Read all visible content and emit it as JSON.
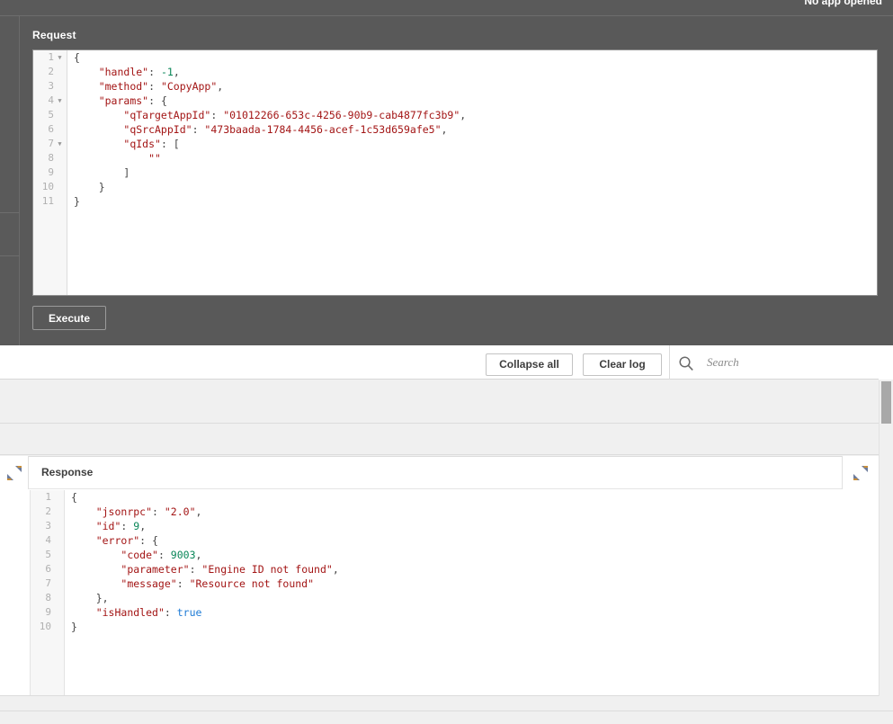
{
  "window": {
    "status_label": "No app opened"
  },
  "request_panel": {
    "title": "Request",
    "execute_label": "Execute",
    "line_count": 11,
    "fold_lines": [
      1,
      4,
      7
    ],
    "json_text": "{\n    \"handle\": -1,\n    \"method\": \"CopyApp\",\n    \"params\": {\n        \"qTargetAppId\": \"01012266-653c-4256-90b9-cab4877fc3b9\",\n        \"qSrcAppId\": \"473baada-1784-4456-acef-1c53d659afe5\",\n        \"qIds\": [\n            \"\"\n        ]\n    }\n}",
    "fields": {
      "handle": -1,
      "method": "CopyApp",
      "qTargetAppId": "01012266-653c-4256-90b9-cab4877fc3b9",
      "qSrcAppId": "473baada-1784-4456-acef-1c53d659afe5",
      "qIds": [
        ""
      ]
    },
    "lines": [
      {
        "n": 1,
        "fold": true,
        "tokens": [
          {
            "t": "{",
            "c": "tk-d"
          }
        ]
      },
      {
        "n": 2,
        "fold": false,
        "tokens": [
          {
            "t": "    ",
            "c": "tk-d"
          },
          {
            "t": "\"handle\"",
            "c": "tk-p"
          },
          {
            "t": ": ",
            "c": "tk-d"
          },
          {
            "t": "-1",
            "c": "tk-n"
          },
          {
            "t": ",",
            "c": "tk-d"
          }
        ]
      },
      {
        "n": 3,
        "fold": false,
        "tokens": [
          {
            "t": "    ",
            "c": "tk-d"
          },
          {
            "t": "\"method\"",
            "c": "tk-p"
          },
          {
            "t": ": ",
            "c": "tk-d"
          },
          {
            "t": "\"CopyApp\"",
            "c": "tk-s"
          },
          {
            "t": ",",
            "c": "tk-d"
          }
        ]
      },
      {
        "n": 4,
        "fold": true,
        "tokens": [
          {
            "t": "    ",
            "c": "tk-d"
          },
          {
            "t": "\"params\"",
            "c": "tk-p"
          },
          {
            "t": ": ",
            "c": "tk-d"
          },
          {
            "t": "{",
            "c": "tk-d"
          }
        ]
      },
      {
        "n": 5,
        "fold": false,
        "tokens": [
          {
            "t": "        ",
            "c": "tk-d"
          },
          {
            "t": "\"qTargetAppId\"",
            "c": "tk-p"
          },
          {
            "t": ": ",
            "c": "tk-d"
          },
          {
            "t": "\"01012266-653c-4256-90b9-cab4877fc3b9\"",
            "c": "tk-s"
          },
          {
            "t": ",",
            "c": "tk-d"
          }
        ]
      },
      {
        "n": 6,
        "fold": false,
        "tokens": [
          {
            "t": "        ",
            "c": "tk-d"
          },
          {
            "t": "\"qSrcAppId\"",
            "c": "tk-p"
          },
          {
            "t": ": ",
            "c": "tk-d"
          },
          {
            "t": "\"473baada-1784-4456-acef-1c53d659afe5\"",
            "c": "tk-s"
          },
          {
            "t": ",",
            "c": "tk-d"
          }
        ]
      },
      {
        "n": 7,
        "fold": true,
        "tokens": [
          {
            "t": "        ",
            "c": "tk-d"
          },
          {
            "t": "\"qIds\"",
            "c": "tk-p"
          },
          {
            "t": ": ",
            "c": "tk-d"
          },
          {
            "t": "[",
            "c": "tk-d"
          }
        ]
      },
      {
        "n": 8,
        "fold": false,
        "tokens": [
          {
            "t": "            ",
            "c": "tk-d"
          },
          {
            "t": "\"\"",
            "c": "tk-s"
          }
        ]
      },
      {
        "n": 9,
        "fold": false,
        "tokens": [
          {
            "t": "        ",
            "c": "tk-d"
          },
          {
            "t": "]",
            "c": "tk-d"
          }
        ]
      },
      {
        "n": 10,
        "fold": false,
        "tokens": [
          {
            "t": "    ",
            "c": "tk-d"
          },
          {
            "t": "}",
            "c": "tk-d"
          }
        ]
      },
      {
        "n": 11,
        "fold": false,
        "tokens": [
          {
            "t": "}",
            "c": "tk-d"
          }
        ]
      }
    ]
  },
  "log_toolbar": {
    "collapse_all_label": "Collapse all",
    "clear_log_label": "Clear log",
    "search_placeholder": "Search",
    "search_value": "",
    "search_icon": "search-icon"
  },
  "response_panel": {
    "title": "Response",
    "expand_left_icon": "expand-diagonal-icon",
    "expand_right_icon": "expand-diagonal-icon",
    "line_count": 10,
    "json_text": "{\n    \"jsonrpc\": \"2.0\",\n    \"id\": 9,\n    \"error\": {\n        \"code\": 9003,\n        \"parameter\": \"Engine ID not found\",\n        \"message\": \"Resource not found\"\n    },\n    \"isHandled\": true\n}",
    "fields": {
      "jsonrpc": "2.0",
      "id": 9,
      "error": {
        "code": 9003,
        "parameter": "Engine ID not found",
        "message": "Resource not found"
      },
      "isHandled": true
    },
    "lines": [
      {
        "n": 1,
        "fold": false,
        "tokens": [
          {
            "t": "{",
            "c": "tk-d"
          }
        ]
      },
      {
        "n": 2,
        "fold": false,
        "tokens": [
          {
            "t": "    ",
            "c": "tk-d"
          },
          {
            "t": "\"jsonrpc\"",
            "c": "tk-p"
          },
          {
            "t": ": ",
            "c": "tk-d"
          },
          {
            "t": "\"2.0\"",
            "c": "tk-s"
          },
          {
            "t": ",",
            "c": "tk-d"
          }
        ]
      },
      {
        "n": 3,
        "fold": false,
        "tokens": [
          {
            "t": "    ",
            "c": "tk-d"
          },
          {
            "t": "\"id\"",
            "c": "tk-p"
          },
          {
            "t": ": ",
            "c": "tk-d"
          },
          {
            "t": "9",
            "c": "tk-n"
          },
          {
            "t": ",",
            "c": "tk-d"
          }
        ]
      },
      {
        "n": 4,
        "fold": false,
        "tokens": [
          {
            "t": "    ",
            "c": "tk-d"
          },
          {
            "t": "\"error\"",
            "c": "tk-p"
          },
          {
            "t": ": ",
            "c": "tk-d"
          },
          {
            "t": "{",
            "c": "tk-d"
          }
        ]
      },
      {
        "n": 5,
        "fold": false,
        "tokens": [
          {
            "t": "        ",
            "c": "tk-d"
          },
          {
            "t": "\"code\"",
            "c": "tk-p"
          },
          {
            "t": ": ",
            "c": "tk-d"
          },
          {
            "t": "9003",
            "c": "tk-n"
          },
          {
            "t": ",",
            "c": "tk-d"
          }
        ]
      },
      {
        "n": 6,
        "fold": false,
        "tokens": [
          {
            "t": "        ",
            "c": "tk-d"
          },
          {
            "t": "\"parameter\"",
            "c": "tk-p"
          },
          {
            "t": ": ",
            "c": "tk-d"
          },
          {
            "t": "\"Engine ID not found\"",
            "c": "tk-s"
          },
          {
            "t": ",",
            "c": "tk-d"
          }
        ]
      },
      {
        "n": 7,
        "fold": false,
        "tokens": [
          {
            "t": "        ",
            "c": "tk-d"
          },
          {
            "t": "\"message\"",
            "c": "tk-p"
          },
          {
            "t": ": ",
            "c": "tk-d"
          },
          {
            "t": "\"Resource not found\"",
            "c": "tk-s"
          }
        ]
      },
      {
        "n": 8,
        "fold": false,
        "tokens": [
          {
            "t": "    ",
            "c": "tk-d"
          },
          {
            "t": "}",
            "c": "tk-d"
          },
          {
            "t": ",",
            "c": "tk-d"
          }
        ]
      },
      {
        "n": 9,
        "fold": false,
        "tokens": [
          {
            "t": "    ",
            "c": "tk-d"
          },
          {
            "t": "\"isHandled\"",
            "c": "tk-p"
          },
          {
            "t": ": ",
            "c": "tk-d"
          },
          {
            "t": "true",
            "c": "tk-b"
          }
        ]
      },
      {
        "n": 10,
        "fold": false,
        "tokens": [
          {
            "t": "}",
            "c": "tk-d"
          }
        ]
      }
    ]
  },
  "colors": {
    "dark_panel": "#595959",
    "editor_bg": "#ffffff",
    "gutter_bg": "#f7f7f7",
    "band_bg": "#f0f0f0",
    "json_key": "#a31515",
    "json_string": "#a31515",
    "json_number": "#098658",
    "json_boolean": "#1e7bd6",
    "scrollbar_thumb": "#a8a8a8"
  }
}
